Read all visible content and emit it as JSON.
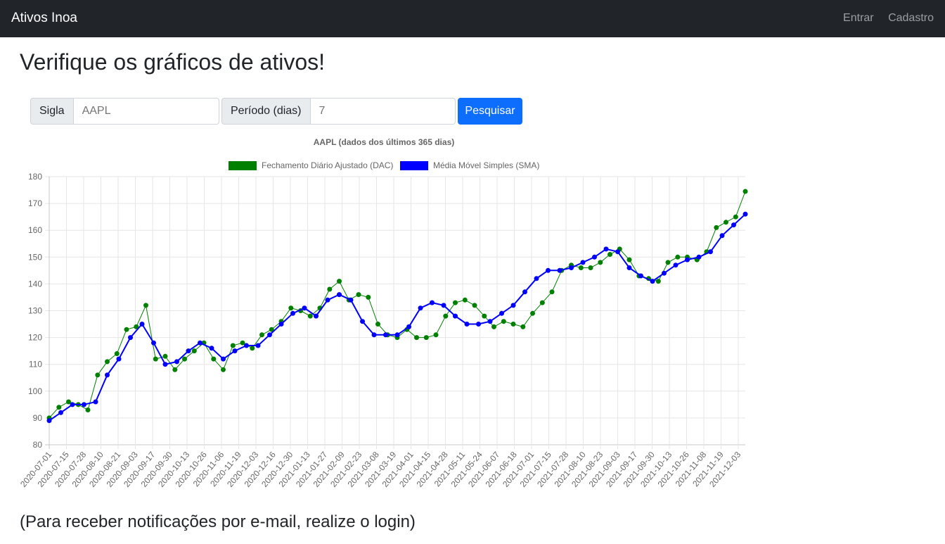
{
  "navbar": {
    "brand": "Ativos Inoa",
    "login": "Entrar",
    "register": "Cadastro"
  },
  "page": {
    "title": "Verifique os gráficos de ativos!",
    "footer": "(Para receber notificações por e-mail, realize o login)"
  },
  "form": {
    "symbol_label": "Sigla",
    "symbol_placeholder": "AAPL",
    "period_label": "Período (dias)",
    "period_placeholder": "7",
    "submit": "Pesquisar"
  },
  "chart_data": {
    "type": "line",
    "title": "AAPL (dados dos últimos 365 dias)",
    "ylim": [
      80,
      180
    ],
    "yticks": [
      80,
      90,
      100,
      110,
      120,
      130,
      140,
      150,
      160,
      170,
      180
    ],
    "grid": true,
    "legend_position": "top",
    "x_tick_labels": [
      "2020-07-01",
      "2020-07-15",
      "2020-07-28",
      "2020-08-10",
      "2020-08-21",
      "2020-09-03",
      "2020-09-17",
      "2020-09-30",
      "2020-10-13",
      "2020-10-26",
      "2020-11-06",
      "2020-11-19",
      "2020-12-03",
      "2020-12-16",
      "2020-12-30",
      "2021-01-13",
      "2021-01-27",
      "2021-02-09",
      "2021-02-23",
      "2021-03-08",
      "2021-03-19",
      "2021-04-01",
      "2021-04-15",
      "2021-04-28",
      "2021-05-11",
      "2021-05-24",
      "2021-06-07",
      "2021-06-18",
      "2021-07-01",
      "2021-07-15",
      "2021-07-28",
      "2021-08-10",
      "2021-08-23",
      "2021-09-03",
      "2021-09-17",
      "2021-09-30",
      "2021-10-13",
      "2021-10-26",
      "2021-11-08",
      "2021-11-19",
      "2021-12-03"
    ],
    "series": [
      {
        "name": "Fechamento Diário Ajustado (DAC)",
        "color": "#008000",
        "values": [
          90,
          94,
          96,
          95,
          93,
          106,
          111,
          114,
          123,
          124,
          132,
          112,
          113,
          108,
          112,
          115,
          118,
          112,
          108,
          117,
          118,
          116,
          121,
          123,
          126,
          131,
          130,
          128,
          131,
          138,
          141,
          134,
          136,
          135,
          125,
          121,
          120,
          123,
          120,
          120,
          121,
          128,
          133,
          134,
          132,
          128,
          124,
          126,
          125,
          124,
          129,
          133,
          137,
          145,
          147,
          146,
          146,
          148,
          151,
          153,
          149,
          143,
          142,
          141,
          148,
          150,
          150,
          149,
          152,
          161,
          163,
          165,
          174.5
        ]
      },
      {
        "name": "Média Móvel Simples (SMA)",
        "color": "#0000ff",
        "values": [
          89,
          92,
          95,
          95,
          96,
          106,
          112,
          120,
          125,
          118,
          110,
          111,
          115,
          118,
          116,
          112,
          115,
          117,
          117,
          121,
          125,
          129,
          131,
          128,
          134,
          136,
          134,
          126,
          121,
          121,
          121,
          124,
          131,
          133,
          132,
          128,
          125,
          125,
          126,
          129,
          132,
          137,
          142,
          145,
          145,
          146,
          148,
          150,
          153,
          152,
          146,
          143,
          141,
          144,
          147,
          149,
          150,
          152,
          158,
          162,
          166
        ]
      }
    ]
  }
}
